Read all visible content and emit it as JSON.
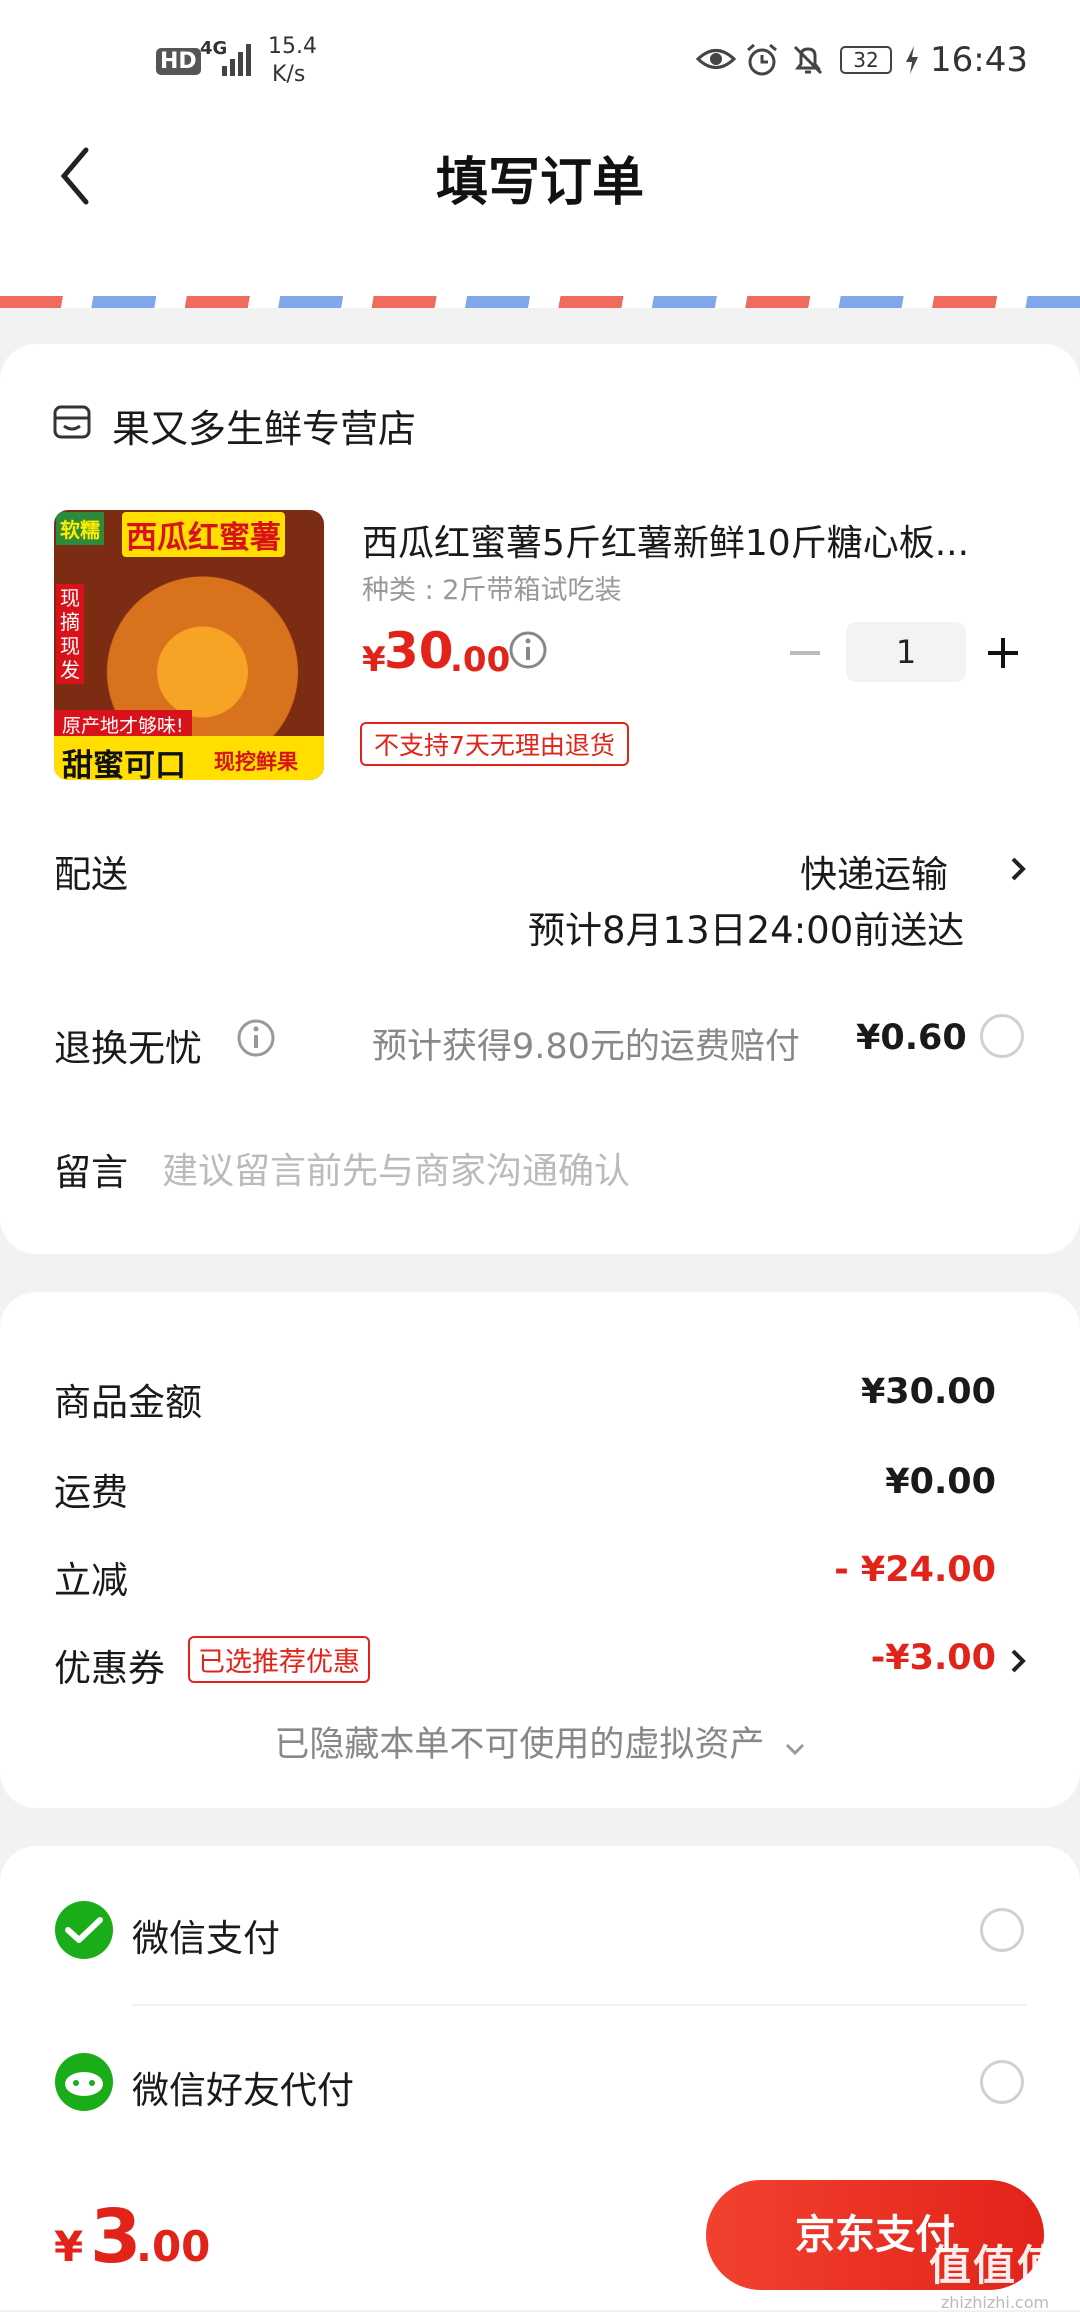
{
  "status_bar": {
    "hd_label": "HD",
    "network": "4G",
    "speed_value": "15.4",
    "speed_unit": "K/s",
    "battery": "32",
    "time": "16:43"
  },
  "header": {
    "title": "填写订单"
  },
  "store": {
    "name": "果又多生鲜专营店",
    "product": {
      "thumb_tag": "软糯",
      "thumb_title": "西瓜红蜜薯",
      "thumb_side": "现摘现发",
      "thumb_banner": "原产地才够味!",
      "thumb_bottom_a": "甜蜜可口",
      "thumb_bottom_b": "现挖鲜果",
      "title": "西瓜红蜜薯5斤红薯新鲜10斤糖心板...",
      "spec": "种类 : 2斤带箱试吃装",
      "price_currency": "¥",
      "price_int": "30",
      "price_dec": ".00",
      "quantity": "1",
      "return_tag": "不支持7天无理由退货"
    },
    "delivery": {
      "label": "配送",
      "method": "快递运输",
      "eta": "预计8月13日24:00前送达"
    },
    "return_insurance": {
      "label": "退换无忧",
      "desc": "预计获得9.80元的运费赔付",
      "price": "¥0.60"
    },
    "message": {
      "label": "留言",
      "placeholder": "建议留言前先与商家沟通确认"
    }
  },
  "summary": {
    "rows": [
      {
        "label": "商品金额",
        "value": "¥30.00"
      },
      {
        "label": "运费",
        "value": "¥0.00"
      },
      {
        "label": "立减",
        "value": "- ¥24.00"
      },
      {
        "label": "优惠券",
        "value": "-¥3.00",
        "tag": "已选推荐优惠"
      }
    ],
    "hidden_note": "已隐藏本单不可使用的虚拟资产"
  },
  "payment": {
    "options": [
      {
        "label": "微信支付"
      },
      {
        "label": "微信好友代付"
      }
    ]
  },
  "footer": {
    "total_currency": "¥",
    "total_int": "3",
    "total_dec": ".00",
    "pay_button": "京东支付",
    "watermark_main": "值值值",
    "watermark_sub": "zhizhizhi.com"
  },
  "colors": {
    "accent_red": "#e2231a",
    "wechat_green": "#1aad19"
  }
}
